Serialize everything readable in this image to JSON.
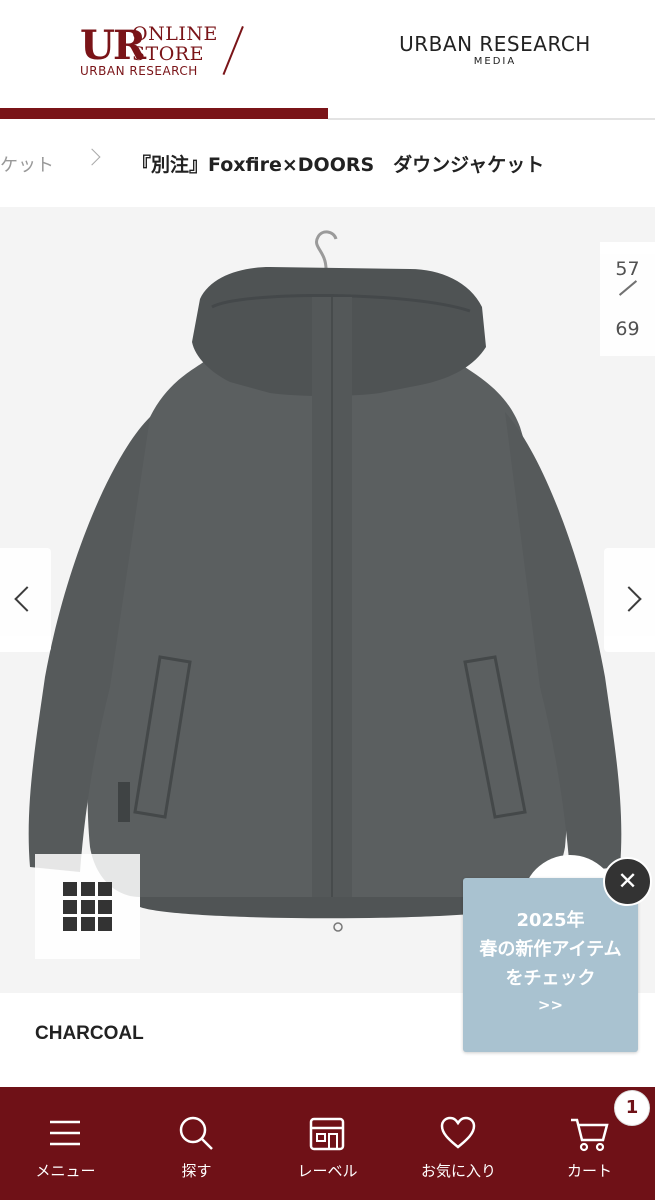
{
  "header": {
    "logo_ur": "UR",
    "logo_online": "ONLINE",
    "logo_store": "STORE",
    "logo_sub": "URBAN RESEARCH",
    "media_title": "URBAN RESEARCH",
    "media_sub": "MEDIA"
  },
  "breadcrumb": {
    "previous": "ケット",
    "current": "『別注』Foxfire×DOORS　ダウンジャケット"
  },
  "gallery": {
    "current_index": "57",
    "total": "69",
    "prev_icon": "chevron-left-icon",
    "next_icon": "chevron-right-icon",
    "grid_icon": "grid-view-icon",
    "background_color": "#f4f4f4",
    "jacket_color": "#5b5f60"
  },
  "color": {
    "name": "CHARCOAL"
  },
  "promo": {
    "line1": "2025年",
    "line2": "春の新作アイテム",
    "line3": "をチェック",
    "line4": ">>",
    "close_label": "✕",
    "background": "#a9c2d0"
  },
  "bottom_nav": {
    "background": "#6f1117",
    "items": [
      {
        "label": "メニュー",
        "icon": "menu-icon"
      },
      {
        "label": "探す",
        "icon": "search-icon"
      },
      {
        "label": "レーベル",
        "icon": "store-icon"
      },
      {
        "label": "お気に入り",
        "icon": "heart-icon"
      },
      {
        "label": "カート",
        "icon": "cart-icon"
      }
    ],
    "cart_count": "1"
  }
}
